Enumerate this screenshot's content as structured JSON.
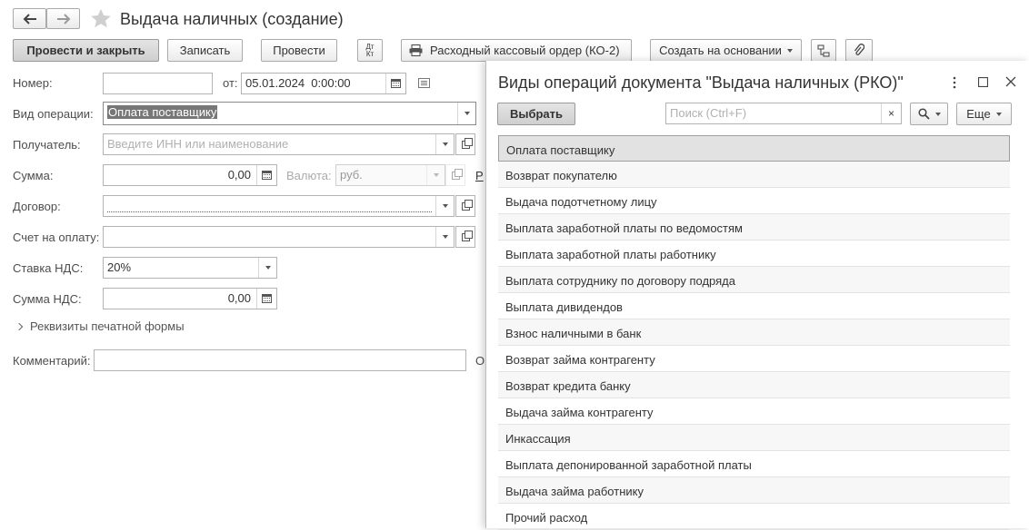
{
  "window": {
    "title": "Выдача наличных (создание)"
  },
  "toolbar": {
    "post_close": "Провести и закрыть",
    "save": "Записать",
    "post": "Провести",
    "dt_kt": "Дт\nКт",
    "print_order": "Расходный кассовый ордер (КО-2)",
    "create_based": "Создать на основании"
  },
  "form": {
    "number_label": "Номер:",
    "number_value": "",
    "date_label": "от:",
    "date_value": "05.01.2024  0:00:00",
    "operation_label": "Вид операции:",
    "operation_value": "Оплата поставщику",
    "recipient_label": "Получатель:",
    "recipient_placeholder": "Введите ИНН или наименование",
    "sum_label": "Сумма:",
    "sum_value": "0,00",
    "currency_label": "Валюта:",
    "currency_value": "руб.",
    "currency_link": "Р",
    "contract_label": "Договор:",
    "invoice_label": "Счет на оплату:",
    "vat_rate_label": "Ставка НДС:",
    "vat_rate_value": "20%",
    "vat_sum_label": "Сумма НДС:",
    "vat_sum_value": "0,00",
    "print_details": "Реквизиты печатной формы",
    "comment_label": "Комментарий:",
    "comment_cut": "О"
  },
  "popup": {
    "title": "Виды операций документа \"Выдача наличных (РКО)\"",
    "select_button": "Выбрать",
    "search_placeholder": "Поиск (Ctrl+F)",
    "more_button": "Еще",
    "items": [
      "Оплата поставщику",
      "Возврат покупателю",
      "Выдача подотчетному лицу",
      "Выплата заработной платы по ведомостям",
      "Выплата заработной платы работнику",
      "Выплата сотруднику по договору подряда",
      "Выплата дивидендов",
      "Взнос наличными в банк",
      "Возврат займа контрагенту",
      "Возврат кредита банку",
      "Выдача займа контрагенту",
      "Инкассация",
      "Выплата депонированной заработной платы",
      "Выдача займа работнику",
      "Прочий расход"
    ],
    "selected_index": 0
  }
}
